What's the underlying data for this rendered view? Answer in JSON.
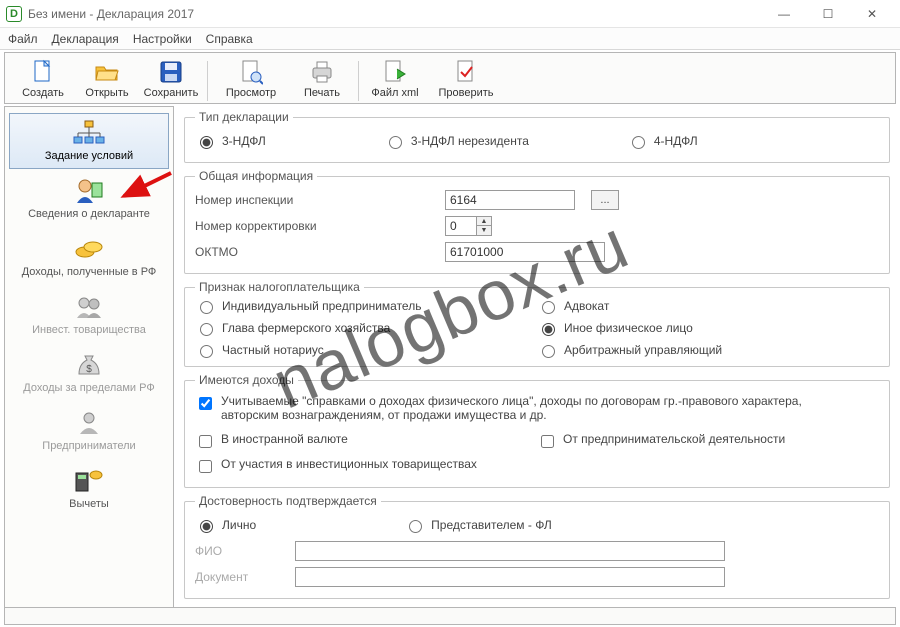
{
  "window": {
    "title": "Без имени - Декларация 2017"
  },
  "menu": {
    "file": "Файл",
    "decl": "Декларация",
    "settings": "Настройки",
    "help": "Справка"
  },
  "toolbar": {
    "create": "Создать",
    "open": "Открыть",
    "save": "Сохранить",
    "preview": "Просмотр",
    "print": "Печать",
    "xml": "Файл xml",
    "check": "Проверить"
  },
  "sidebar": {
    "items": [
      {
        "label": "Задание условий"
      },
      {
        "label": "Сведения о декларанте"
      },
      {
        "label": "Доходы, полученные в РФ"
      },
      {
        "label": "Инвест. товарищества"
      },
      {
        "label": "Доходы за пределами РФ"
      },
      {
        "label": "Предприниматели"
      },
      {
        "label": "Вычеты"
      }
    ]
  },
  "type": {
    "legend": "Тип декларации",
    "opt1": "3-НДФЛ",
    "opt2": "3-НДФЛ нерезидента",
    "opt3": "4-НДФЛ"
  },
  "general": {
    "legend": "Общая информация",
    "inspection_label": "Номер инспекции",
    "inspection_value": "6164",
    "correction_label": "Номер корректировки",
    "correction_value": "0",
    "oktmo_label": "ОКТМО",
    "oktmo_value": "61701000",
    "pick": "..."
  },
  "taxpayer": {
    "legend": "Признак налогоплательщика",
    "opt_ip": "Индивидуальный предприниматель",
    "opt_farmer": "Глава фермерского хозяйства",
    "opt_notary": "Частный нотариус",
    "opt_advocate": "Адвокат",
    "opt_other": "Иное физическое лицо",
    "opt_arbitr": "Арбитражный управляющий"
  },
  "income": {
    "legend": "Имеются доходы",
    "chk_main": "Учитываемые \"справками о доходах физического лица\", доходы по договорам гр.-правового характера, авторским вознаграждениям, от продажи имущества и др.",
    "chk_fx": "В иностранной валюте",
    "chk_biz": "От предпринимательской деятельности",
    "chk_invest": "От участия в инвестиционных товариществах"
  },
  "reliab": {
    "legend": "Достоверность подтверждается",
    "opt_self": "Лично",
    "opt_rep": "Представителем - ФЛ",
    "fio": "ФИО",
    "doc": "Документ"
  },
  "watermark": "nalogbox.ru"
}
